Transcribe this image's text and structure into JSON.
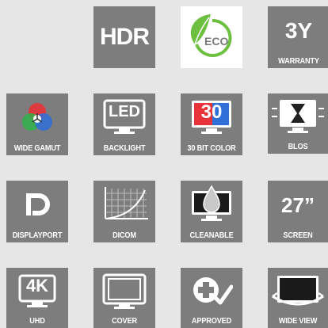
{
  "tiles": {
    "hdr": {
      "title": "HDR",
      "icon": "hdr-text-icon"
    },
    "eco": {
      "text": "ECO",
      "icon": "eco-leaf-icon",
      "colors": {
        "leaf": "#6cbf3f",
        "text": "#7a7a7a"
      }
    },
    "warranty": {
      "top": "3Y",
      "label": "WARRANTY",
      "icon": "warranty-text-icon"
    },
    "wide_gamut": {
      "label": "WIDE GAMUT",
      "icon": "rgb-circles-icon"
    },
    "backlight": {
      "icon_text": "LED",
      "label": "BACKLIGHT",
      "icon": "led-monitor-icon"
    },
    "color30": {
      "icon_text": "30",
      "label": "30 BIT COLOR",
      "icon": "color-monitor-icon"
    },
    "blos": {
      "label": "BLOS",
      "icon": "hourglass-monitor-icon"
    },
    "displayport": {
      "label": "DISPLAYPORT",
      "icon": "displayport-logo-icon"
    },
    "dicom": {
      "label": "DICOM",
      "icon": "dicom-curve-icon"
    },
    "cleanable": {
      "label": "CLEANABLE",
      "icon": "drop-monitor-icon"
    },
    "screen": {
      "top": "27”",
      "label": "SCREEN",
      "icon": "screen-size-text-icon"
    },
    "uhd": {
      "icon_text": "4K",
      "label": "UHD",
      "icon": "4k-monitor-icon"
    },
    "cover": {
      "label": "COVER",
      "icon": "monitor-cover-icon"
    },
    "approved": {
      "label": "APPROVED",
      "icon": "medical-cross-check-icon"
    },
    "wide_view": {
      "label": "WIDE VIEW",
      "icon": "wide-view-monitor-icon"
    }
  },
  "colors": {
    "tile_bg": "#7d7d7d",
    "page_bg": "#e6e6e6"
  }
}
